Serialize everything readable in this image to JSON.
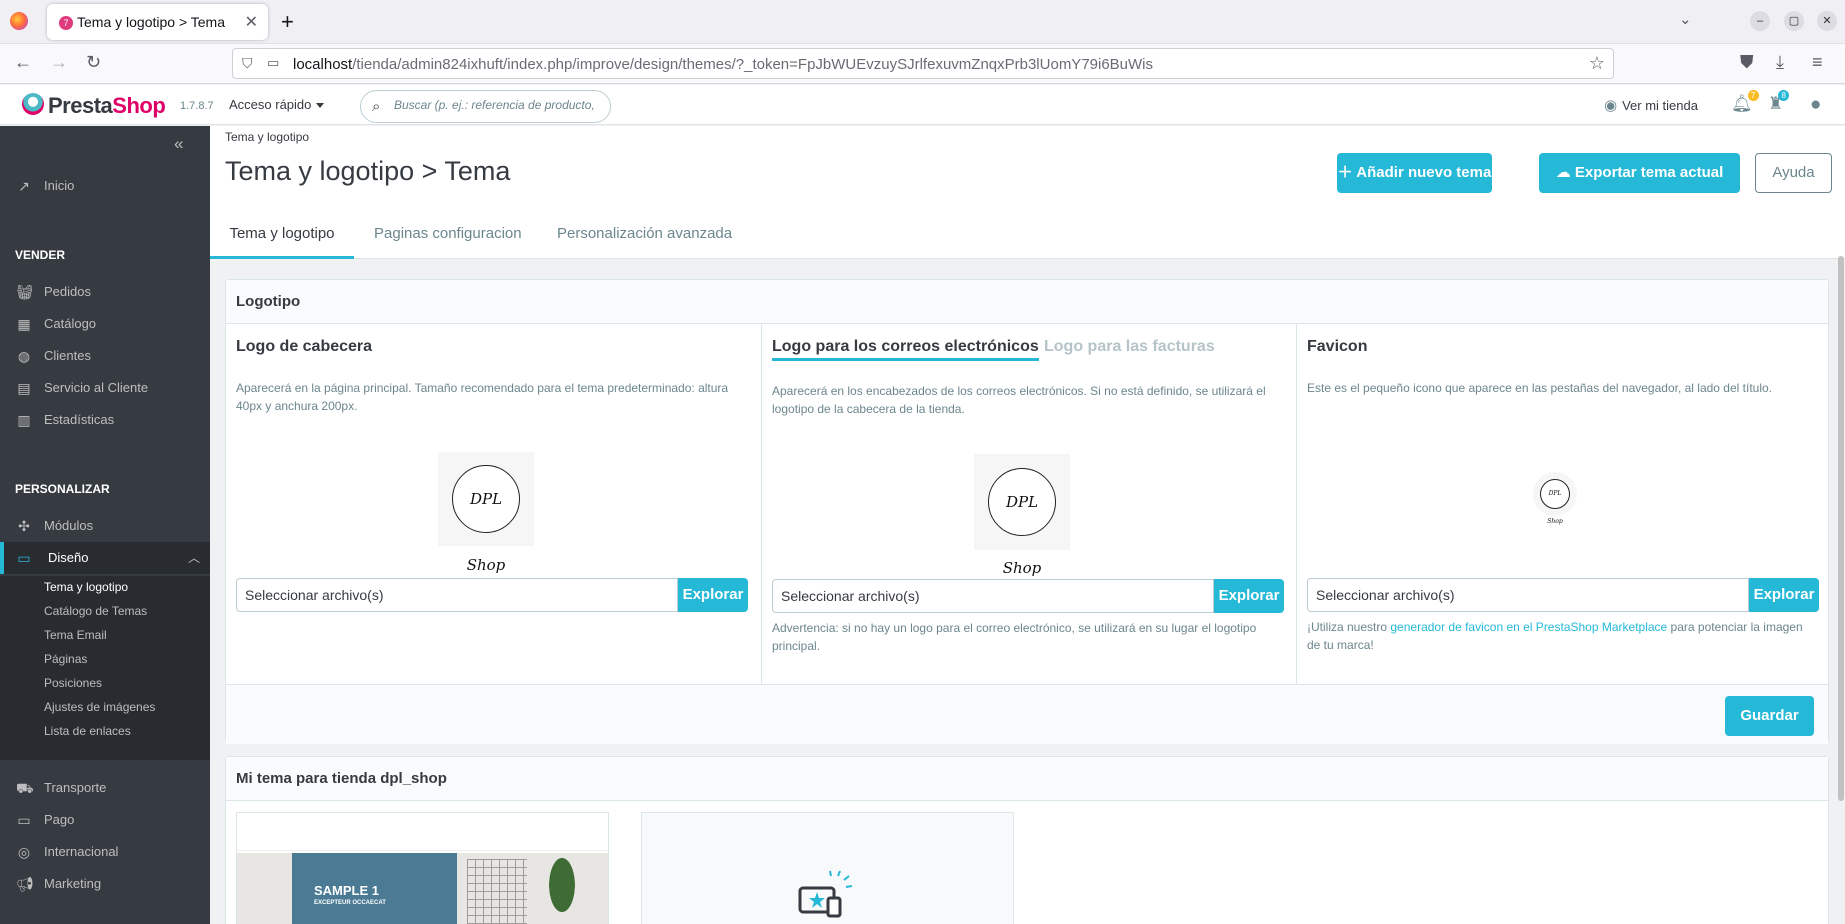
{
  "browser": {
    "tab_title": "Tema y logotipo > Tema",
    "url_host": "localhost",
    "url_path": "/tienda/admin824ixhuft/index.php/improve/design/themes/?_token=FpJbWUEvzuySJrlfexuvmZnqxPrb3lUomY79i6BuWis"
  },
  "header": {
    "brand_a": "Presta",
    "brand_b": "Shop",
    "version": "1.7.8.7",
    "quick_access": "Acceso rápido",
    "search_placeholder": "Buscar (p. ej.: referencia de producto,",
    "view_shop": "Ver mi tienda",
    "notif_count": "7",
    "orders_count": "8"
  },
  "sidebar": {
    "home": "Inicio",
    "sections": {
      "sell": "VENDER",
      "customize": "PERSONALIZAR"
    },
    "sell_items": [
      "Pedidos",
      "Catálogo",
      "Clientes",
      "Servicio al Cliente",
      "Estadísticas"
    ],
    "modules": "Módulos",
    "design": "Diseño",
    "design_sub": [
      "Tema y logotipo",
      "Catálogo de Temas",
      "Tema Email",
      "Páginas",
      "Posiciones",
      "Ajustes de imágenes",
      "Lista de enlaces"
    ],
    "bottom_items": [
      "Transporte",
      "Pago",
      "Internacional",
      "Marketing"
    ]
  },
  "page": {
    "breadcrumb": "Tema y logotipo",
    "title": "Tema y logotipo > Tema",
    "btn_add": "Añadir nuevo tema",
    "btn_export": "Exportar tema actual",
    "btn_help": "Ayuda",
    "tabs": [
      "Tema y logotipo",
      "Paginas configuracion",
      "Personalización avanzada"
    ]
  },
  "logo_card": {
    "title": "Logotipo",
    "header_logo": {
      "title": "Logo de cabecera",
      "desc": "Aparecerá en la página principal. Tamaño recomendado para el tema predeterminado: altura 40px y anchura 200px."
    },
    "mail_logo": {
      "title": "Logo para los correos electrónicos",
      "alt_title": "Logo para las facturas",
      "desc": "Aparecerá en los encabezados de los correos electrónicos. Si no está definido, se utilizará el logotipo de la cabecera de la tienda.",
      "warning": "Advertencia: si no hay un logo para el correo electrónico, se utilizará en su lugar el logotipo principal."
    },
    "favicon": {
      "title": "Favicon",
      "desc": "Este es el pequeño icono que aparece en las pestañas del navegador, al lado del título.",
      "note_pre": "¡Utiliza nuestro ",
      "note_link": "generador de favicon en el PrestaShop Marketplace",
      "note_post": " para potenciar la imagen de tu marca!"
    },
    "logo_text": "DPL Shop",
    "file_placeholder": "Seleccionar archivo(s)",
    "browse": "Explorar",
    "save": "Guardar"
  },
  "theme_card": {
    "title": "Mi tema para tienda dpl_shop",
    "sample_title": "SAMPLE 1",
    "sample_sub": "EXCEPTEUR OCCAECAT"
  },
  "colors": {
    "accent": "#25b9d7",
    "sidebar": "#363a41",
    "brand_pink": "#df0067"
  }
}
